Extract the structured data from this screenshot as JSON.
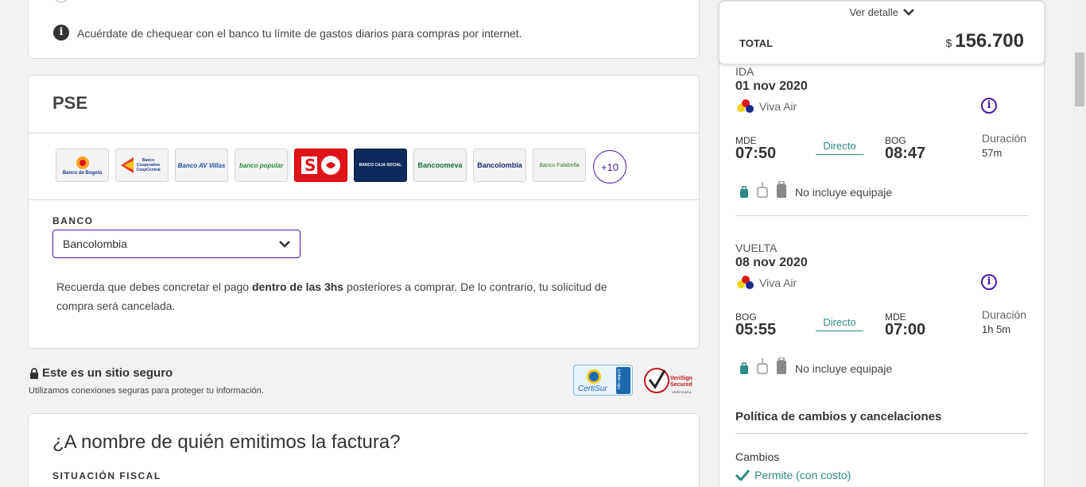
{
  "info_notice": "Acuérdate de chequear con el banco tu límite de gastos diarios para compras por internet.",
  "pse": {
    "title": "PSE",
    "banks": [
      {
        "name": "Banco de Bogotá",
        "color": "#1a3a8a",
        "bg": "#f0f0f0"
      },
      {
        "name": "Banco Cooperativo CoopCentral",
        "color": "#1a3a8a",
        "bg": "#f0f0f0"
      },
      {
        "name": "Banco AV Villas",
        "color": "#1f4fa8",
        "bg": "#f0f0f0"
      },
      {
        "name": "banco popular",
        "color": "#2a8a3a",
        "bg": "#f0f0f0"
      },
      {
        "name": "Banco Santander",
        "color": "#ffffff",
        "bg": "#e0131b"
      },
      {
        "name": "BANCO CAJA SOCIAL",
        "color": "#ffffff",
        "bg": "#0d2a5c"
      },
      {
        "name": "Bancoomeva",
        "color": "#1c6d3a",
        "bg": "#f0f0f0"
      },
      {
        "name": "Bancolombia",
        "color": "#1a2a6c",
        "bg": "#f0f0f0"
      },
      {
        "name": "Banco Falabella",
        "color": "#3a7a2a",
        "bg": "#f0f0f0"
      }
    ],
    "more_label": "+10",
    "bank_label": "BANCO",
    "bank_selected": "Bancolombia",
    "notice_pre": "Recuerda que debes concretar el pago ",
    "notice_bold": "dentro de las 3hs",
    "notice_post": " posteriores a comprar. De lo contrario, tu solicitud de compra será cancelada."
  },
  "secure": {
    "title": "Este es un sitio seguro",
    "subtitle": "Utilizamos conexiones seguras para proteger tu información.",
    "certisur_label": "CertiSur",
    "certisur_side": "sitio seguro",
    "verisign_label": "VeriSign Secured",
    "verisign_sub": "VERIFICAR"
  },
  "factura": {
    "title": "¿A nombre de quién emitimos la factura?",
    "fiscal_label": "SITUACIÓN FISCAL"
  },
  "summary": {
    "ver_detalle": "Ver detalle",
    "total_label": "TOTAL",
    "currency": "$",
    "total_amount": "156.700",
    "legs": [
      {
        "label": "IDA",
        "date": "01 nov 2020",
        "airline": "Viva Air",
        "from_code": "MDE",
        "from_time": "07:50",
        "stop": "Directo",
        "to_code": "BOG",
        "to_time": "08:47",
        "duration_label": "Duración",
        "duration": "57m",
        "baggage": "No incluye equipaje"
      },
      {
        "label": "VUELTA",
        "date": "08 nov 2020",
        "airline": "Viva Air",
        "from_code": "BOG",
        "from_time": "05:55",
        "stop": "Directo",
        "to_code": "MDE",
        "to_time": "07:00",
        "duration_label": "Duración",
        "duration": "1h 5m",
        "baggage": "No incluye equipaje"
      }
    ],
    "policy_title": "Política de cambios y cancelaciones",
    "cambios_label": "Cambios",
    "cambios_value": "Permite (con costo)"
  },
  "colors": {
    "accent_purple": "#4a1aa8",
    "teal": "#2a8c82"
  }
}
